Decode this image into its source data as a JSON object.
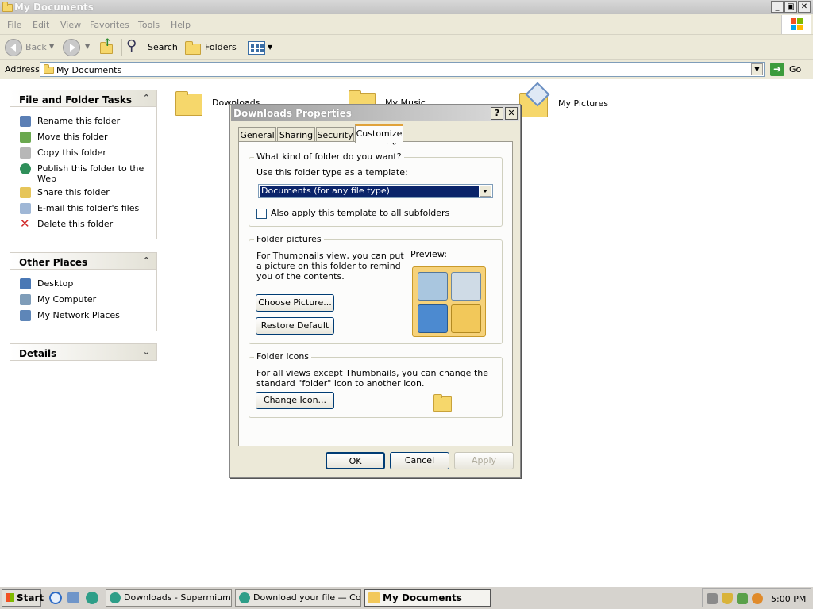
{
  "window": {
    "title": "My Documents",
    "menu": [
      "File",
      "Edit",
      "View",
      "Favorites",
      "Tools",
      "Help"
    ],
    "toolbar": {
      "back": "Back",
      "search": "Search",
      "folders": "Folders"
    },
    "address": {
      "label": "Address",
      "value": "My Documents",
      "go": "Go"
    }
  },
  "tasks_panel": {
    "title": "File and Folder Tasks",
    "items": [
      {
        "label": "Rename this folder",
        "icon": "rename-icon"
      },
      {
        "label": "Move this folder",
        "icon": "move-icon"
      },
      {
        "label": "Copy this folder",
        "icon": "copy-icon"
      },
      {
        "label": "Publish this folder to the Web",
        "icon": "publish-icon"
      },
      {
        "label": "Share this folder",
        "icon": "share-icon"
      },
      {
        "label": "E-mail this folder's files",
        "icon": "email-icon"
      },
      {
        "label": "Delete this folder",
        "icon": "delete-icon"
      }
    ]
  },
  "places_panel": {
    "title": "Other Places",
    "items": [
      {
        "label": "Desktop",
        "icon": "desktop-icon"
      },
      {
        "label": "My Computer",
        "icon": "computer-icon"
      },
      {
        "label": "My Network Places",
        "icon": "network-icon"
      }
    ]
  },
  "details_panel": {
    "title": "Details"
  },
  "files": [
    {
      "label": "Downloads",
      "icon": "folder-icon"
    },
    {
      "label": "My Music",
      "icon": "music-folder-icon"
    },
    {
      "label": "My Pictures",
      "icon": "pictures-folder-icon"
    }
  ],
  "dialog": {
    "title": "Downloads Properties",
    "tabs": [
      "General",
      "Sharing",
      "Security",
      "Customize"
    ],
    "selected_tab": "Customize",
    "folder_type_group": {
      "label": "What kind of folder do you want?",
      "template_label": "Use this folder type as a template:",
      "template_value": "Documents (for any file type)",
      "subfolders_checkbox": "Also apply this template to all subfolders",
      "subfolders_checked": false
    },
    "folder_pictures_group": {
      "label": "Folder pictures",
      "description": "For Thumbnails view, you can put a picture on this folder to remind you of the contents.",
      "preview_label": "Preview:",
      "choose_button": "Choose Picture...",
      "restore_button": "Restore Default"
    },
    "folder_icons_group": {
      "label": "Folder icons",
      "description": "For all views except Thumbnails, you can change the standard \"folder\" icon to another icon.",
      "change_button": "Change Icon..."
    },
    "buttons": {
      "ok": "OK",
      "cancel": "Cancel",
      "apply": "Apply"
    }
  },
  "taskbar": {
    "start": "Start",
    "tasks": [
      {
        "label": "Downloads - Supermium",
        "active": false
      },
      {
        "label": "Download your file — Co...",
        "active": false
      },
      {
        "label": "My Documents",
        "active": true
      }
    ],
    "clock": "5:00 PM"
  }
}
